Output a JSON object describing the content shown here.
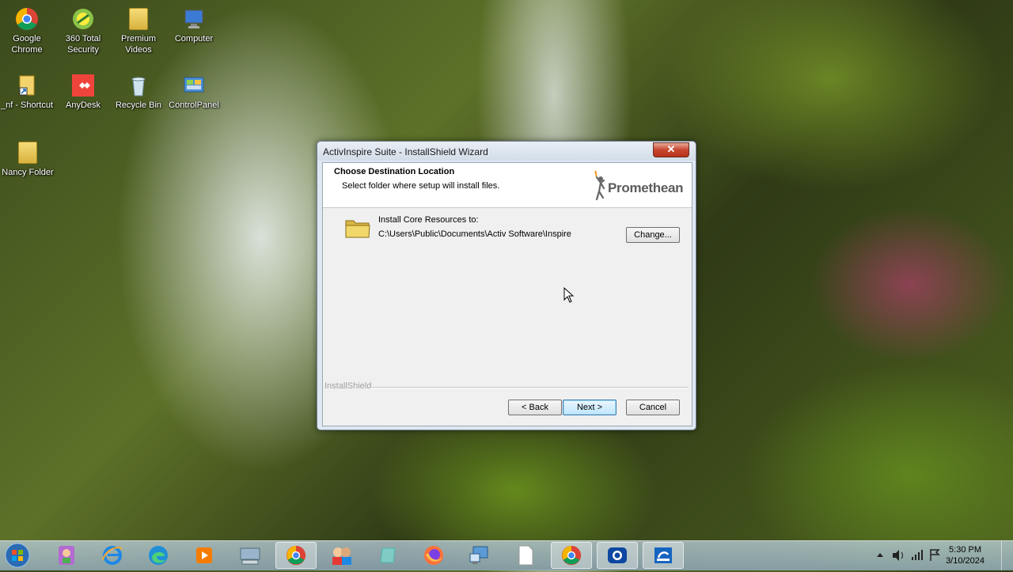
{
  "desktop": {
    "icons": [
      {
        "label": "Google Chrome",
        "icon": "chrome-icon"
      },
      {
        "label": "360 Total Security",
        "icon": "security-icon"
      },
      {
        "label": "Premium Videos",
        "icon": "folder-icon"
      },
      {
        "label": "Computer",
        "icon": "computer-icon"
      },
      {
        "label": "_nf - Shortcut",
        "icon": "shortcut-icon"
      },
      {
        "label": "AnyDesk",
        "icon": "anydesk-icon"
      },
      {
        "label": "Recycle Bin",
        "icon": "recycle-bin-icon"
      },
      {
        "label": "ControlPanel",
        "icon": "control-panel-icon"
      },
      {
        "label": "Nancy Folder",
        "icon": "folder-icon"
      }
    ]
  },
  "wizard": {
    "title": "ActivInspire Suite - InstallShield Wizard",
    "close_label": "✕",
    "header_title": "Choose Destination Location",
    "header_subtitle": "Select folder where setup will install files.",
    "logo_text": "Promethean",
    "install_label": "Install Core Resources to:",
    "install_path": "C:\\Users\\Public\\Documents\\Activ Software\\Inspire",
    "change_button": "Change...",
    "brand": "InstallShield",
    "back_button": "< Back",
    "next_button": "Next >",
    "cancel_button": "Cancel"
  },
  "taskbar": {
    "items": [
      "start-orb",
      "user-app-icon",
      "internet-explorer-icon",
      "edge-icon",
      "media-player-icon",
      "keyboard-app-icon",
      "chrome-icon",
      "people-app-icon",
      "notes-app-icon",
      "firefox-icon",
      "network-app-icon",
      "blank-document-icon",
      "chrome-icon",
      "screen-recorder-icon",
      "installer-icon"
    ],
    "time": "5:30 PM",
    "date": "3/10/2024"
  },
  "colors": {
    "default_button_border": "#3c7fb1",
    "close_button": "#c7462f",
    "logo_orange": "#f29a1f"
  }
}
